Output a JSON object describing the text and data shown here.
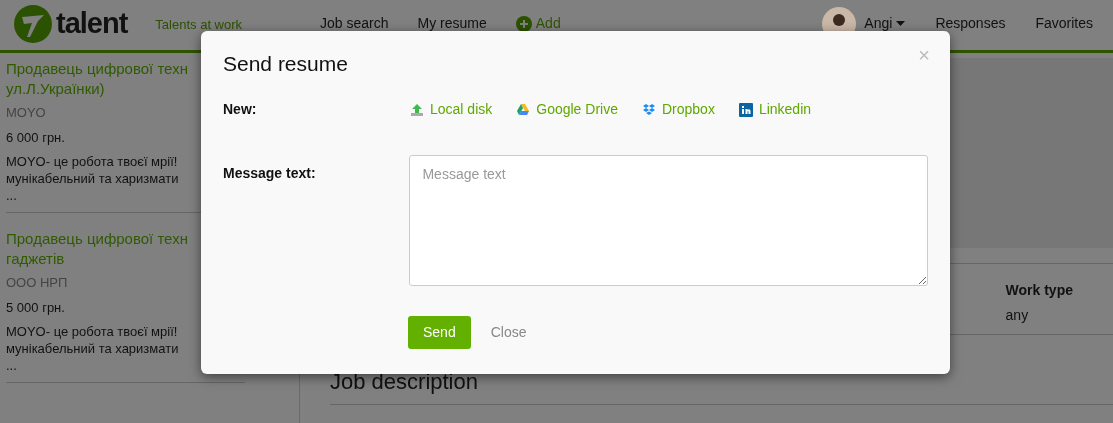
{
  "header": {
    "logo": "talent",
    "tagline": "Talents at work",
    "nav": [
      {
        "label": "Job search",
        "kind": "plain"
      },
      {
        "label": "My resume",
        "kind": "plain"
      },
      {
        "label": "Add",
        "kind": "add"
      }
    ],
    "user": "Angi",
    "links": [
      "Responses",
      "Favorites"
    ]
  },
  "jobs": [
    {
      "title_lines": [
        "Продавець цифрової техн",
        "ул.Л.Українки)"
      ],
      "company": "MOYO",
      "salary": "6 000 грн.",
      "desc_lines": [
        "MOYO- це робота твоєї мрії!",
        "мунікабельний та харизмати",
        "..."
      ]
    },
    {
      "title_lines": [
        "Продавець цифрової техн",
        "гаджетів"
      ],
      "company": "ООО НРП",
      "salary": "5 000 грн.",
      "desc_lines": [
        "MOYO- це робота твоєї мрії!",
        "мунікабельний та харизмати",
        "..."
      ]
    }
  ],
  "details": [
    {
      "label": "Work type",
      "value": "any"
    }
  ],
  "section_heading": "Job description",
  "modal": {
    "title": "Send resume",
    "close_icon": "×",
    "new_label": "New:",
    "sources": [
      {
        "label": "Local disk",
        "kind": "local"
      },
      {
        "label": "Google Drive",
        "kind": "gdrive"
      },
      {
        "label": "Dropbox",
        "kind": "dropbox"
      },
      {
        "label": "Linkedin",
        "kind": "linkedin"
      }
    ],
    "message_label": "Message text:",
    "message_placeholder": "Message text",
    "send": "Send",
    "close": "Close"
  }
}
